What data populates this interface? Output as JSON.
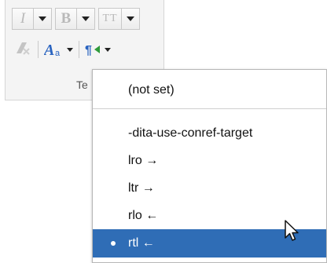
{
  "toolbar": {
    "italic_label": "I",
    "bold_label": "B",
    "small_caps_label": "TT",
    "group_label_fragment": "Te"
  },
  "menu": {
    "items": [
      {
        "label": "(not set)",
        "selected": false
      },
      {
        "label": "-dita-use-conref-target",
        "selected": false
      },
      {
        "label": "lro →",
        "selected": false
      },
      {
        "label": "ltr →",
        "selected": false
      },
      {
        "label": "rlo ←",
        "selected": false
      },
      {
        "label": "rtl ←",
        "selected": true
      }
    ]
  },
  "colors": {
    "selection": "#2f6db6",
    "accent_green": "#2e9a3a",
    "accent_blue": "#2a64c0"
  }
}
